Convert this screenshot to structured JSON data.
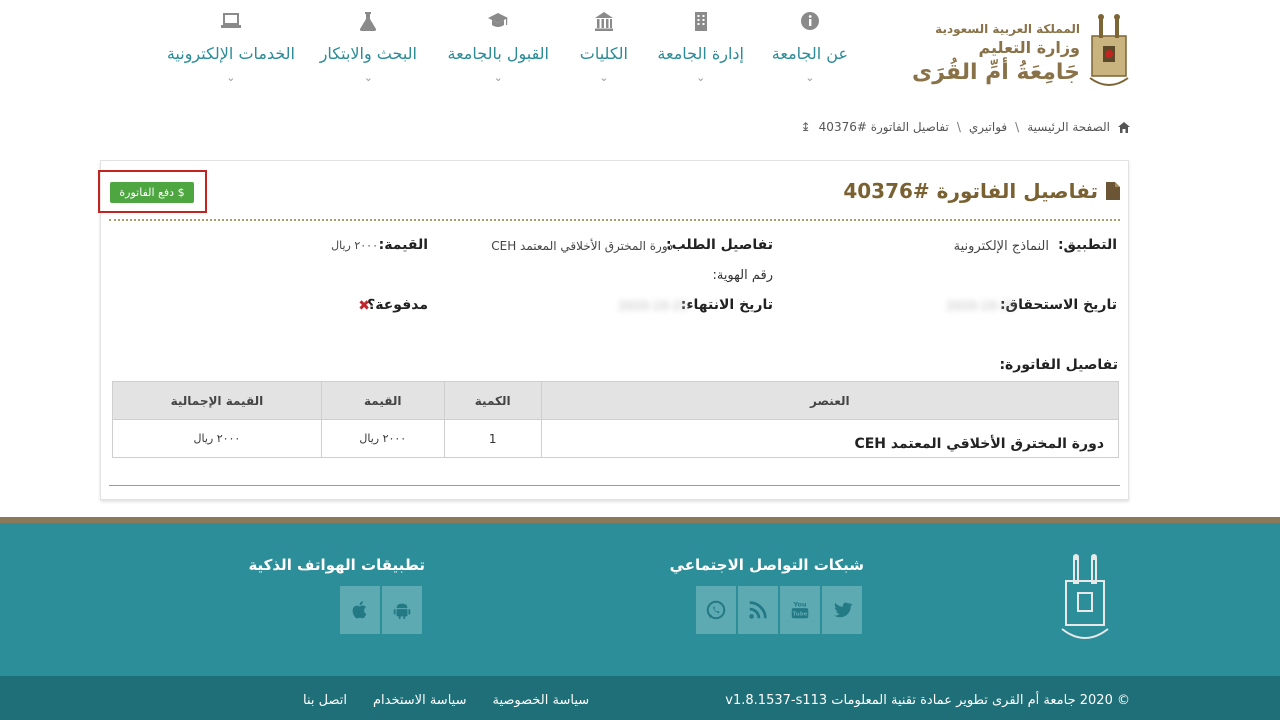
{
  "header": {
    "logo": {
      "line1": "المملكة العربية السعودية",
      "line2": "وزارة التعليم",
      "line3": "جَامِعَةُ أمِّ القُرَى"
    },
    "nav": [
      {
        "label": "عن الجامعة",
        "icon": "info-icon"
      },
      {
        "label": "إدارة الجامعة",
        "icon": "building-icon"
      },
      {
        "label": "الكليات",
        "icon": "institution-icon"
      },
      {
        "label": "القبول بالجامعة",
        "icon": "graduation-cap-icon"
      },
      {
        "label": "البحث والابتكار",
        "icon": "flask-icon"
      },
      {
        "label": "الخدمات الإلكترونية",
        "icon": "laptop-icon"
      }
    ],
    "chevron": "⌄"
  },
  "breadcrumb": {
    "home": "الصفحة الرئيسية",
    "sep": "\\",
    "invoices": "فواتيري",
    "current": "تفاصيل الفاتورة #40376"
  },
  "panel": {
    "title": "تفاصيل الفاتورة #40376",
    "pay_button": "$ دفع الفاتورة",
    "application_label": "التطبيق:",
    "application_value": "النماذج الإلكترونية",
    "request_label": "تفاصيل الطلب:",
    "request_value": "دورة المخترق الأخلاقي المعتمد CEH",
    "id_label": "رقم الهوية:",
    "amount_label": "القيمة:",
    "amount_value": "٢٠٠٠ ريال",
    "due_label": "تاريخ الاستحقاق:",
    "due_value": "2020-10-25",
    "expiry_label": "تاريخ الانتهاء:",
    "expiry_value": "2020-10-25",
    "paid_label": "مدفوعة؟",
    "paid_mark": "✖",
    "details_label": "تفاصيل الفاتورة:",
    "table": {
      "headers": [
        "العنصر",
        "الكمية",
        "القيمة",
        "القيمة الإجمالية"
      ],
      "rows": [
        {
          "item": "دورة المخترق الأخلاقي المعتمد CEH",
          "qty": "1",
          "price": "٢٠٠٠ ريال",
          "total": "٢٠٠٠ ريال"
        }
      ]
    }
  },
  "footer": {
    "social_heading": "شبكات التواصل الاجتماعي",
    "apps_heading": "تطبيقات الهواتف الذكية",
    "copyright": "© 2020 جامعة أم القرى تطوير عمادة تقنية المعلومات v1.8.1537-s113",
    "links": [
      "سياسة الخصوصية",
      "سياسة الاستخدام",
      "اتصل بنا"
    ]
  },
  "colors": {
    "accent_teal": "#2b8e99",
    "gold": "#8a7a5a",
    "pay_green": "#4ea640",
    "highlight_red": "#c2241f"
  }
}
